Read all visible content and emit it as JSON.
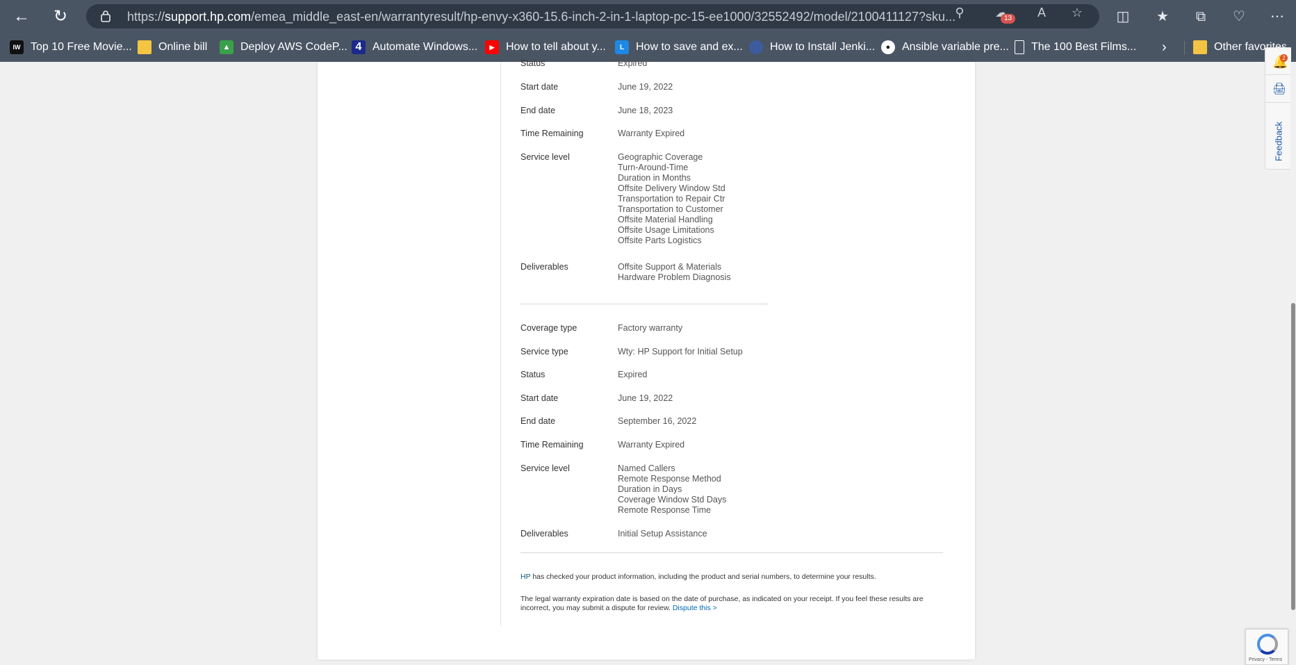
{
  "browser": {
    "url_prefix": "https://",
    "url_host": "support.hp.com",
    "url_path": "/emea_middle_east-en/warrantyresult/hp-envy-x360-15.6-inch-2-in-1-laptop-pc-15-ee1000/32552492/model/2100411127?sku...",
    "extension_badge": "13"
  },
  "bookmarks": [
    {
      "label": "Top 10 Free Movie...",
      "icon": "iw-icon"
    },
    {
      "label": "Online bill",
      "icon": "folder-icon"
    },
    {
      "label": "Deploy AWS CodeP...",
      "icon": "aws-icon"
    },
    {
      "label": "Automate Windows...",
      "icon": "channel4-icon"
    },
    {
      "label": "How to tell about y...",
      "icon": "youtube-icon"
    },
    {
      "label": "How to save and ex...",
      "icon": "lc-icon"
    },
    {
      "label": "How to Install Jenki...",
      "icon": "globe-icon"
    },
    {
      "label": "Ansible variable pre...",
      "icon": "github-icon"
    },
    {
      "label": "The 100 Best Films...",
      "icon": "page-icon"
    }
  ],
  "other_favorites": "Other favorites",
  "warranty1": {
    "status_label": "Status",
    "status": "Expired",
    "start_label": "Start date",
    "start": "June 19, 2022",
    "end_label": "End date",
    "end": "June 18, 2023",
    "remaining_label": "Time Remaining",
    "remaining": "Warranty Expired",
    "service_level_label": "Service level",
    "service_levels": [
      "Geographic Coverage",
      "Turn-Around-Time",
      "Duration in Months",
      "Offsite Delivery Window Std",
      "Transportation to Repair Ctr",
      "Transportation to Customer",
      "Offsite Material Handling",
      "Offsite Usage Limitations",
      "Offsite Parts Logistics"
    ],
    "deliverables_label": "Deliverables",
    "deliverables": [
      "Offsite Support & Materials",
      "Hardware Problem Diagnosis"
    ]
  },
  "warranty2": {
    "coverage_label": "Coverage type",
    "coverage": "Factory warranty",
    "service_type_label": "Service type",
    "service_type": "Wty: HP Support for Initial Setup",
    "status_label": "Status",
    "status": "Expired",
    "start_label": "Start date",
    "start": "June 19, 2022",
    "end_label": "End date",
    "end": "September 16, 2022",
    "remaining_label": "Time Remaining",
    "remaining": "Warranty Expired",
    "service_level_label": "Service level",
    "service_levels": [
      "Named Callers",
      "Remote Response Method",
      "Duration in Days",
      "Coverage Window Std Days",
      "Remote Response Time"
    ],
    "deliverables_label": "Deliverables",
    "deliverables": [
      "Initial Setup Assistance"
    ]
  },
  "notes": {
    "hp": "HP",
    "checked": " has checked your product information, including the product and serial numbers, to determine your results.",
    "legal": "The legal warranty expiration date is based on the date of purchase, as indicated on your receipt. If you feel these results are incorrect, you may submit a dispute for review. ",
    "dispute_link": "Dispute this >"
  },
  "side": {
    "notification_count": "2",
    "feedback": "Feedback"
  },
  "recaptcha": "Privacy - Terms"
}
